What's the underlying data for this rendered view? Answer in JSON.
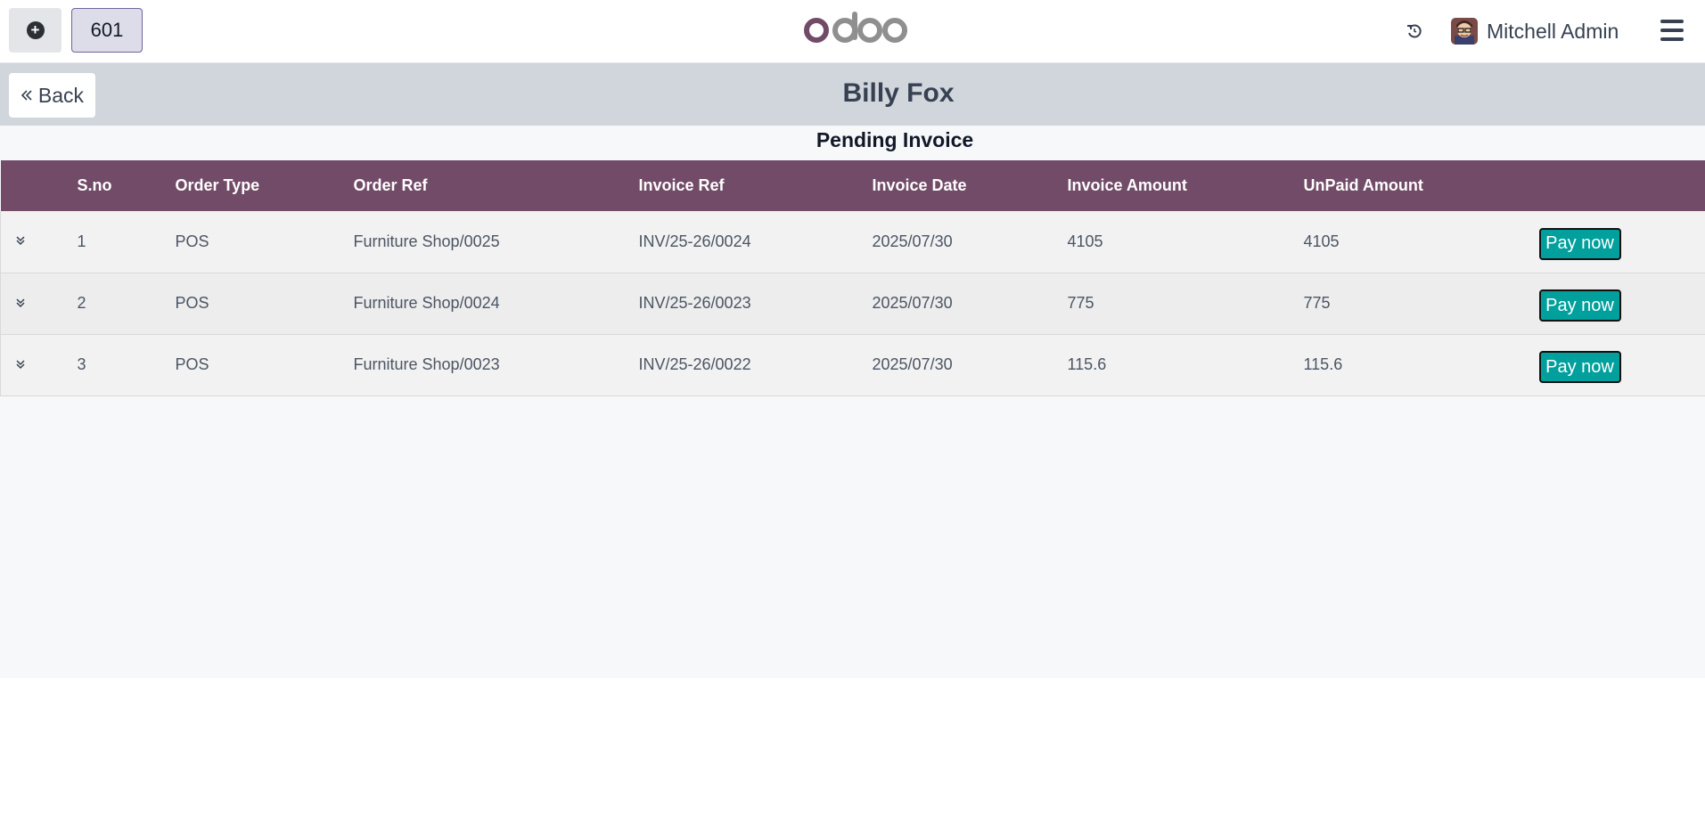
{
  "navbar": {
    "table_number": "601",
    "brand": "odoo",
    "user_name": "Mitchell Admin",
    "icons": [
      "plus-circle-icon",
      "sync-icon",
      "hamburger-menu-icon"
    ]
  },
  "header": {
    "back_label": "Back",
    "title": "Billy Fox"
  },
  "main": {
    "section_title": "Pending Invoice",
    "columns": [
      "S.no",
      "Order Type",
      "Order Ref",
      "Invoice Ref",
      "Invoice Date",
      "Invoice Amount",
      "UnPaid Amount"
    ],
    "rows": [
      {
        "sno": "1",
        "order_type": "POS",
        "order_ref": "Furniture Shop/0025",
        "invoice_ref": "INV/25-26/0024",
        "invoice_date": "2025/07/30",
        "invoice_amount": "4105",
        "unpaid_amount": "4105",
        "action": "Pay now"
      },
      {
        "sno": "2",
        "order_type": "POS",
        "order_ref": "Furniture Shop/0024",
        "invoice_ref": "INV/25-26/0023",
        "invoice_date": "2025/07/30",
        "invoice_amount": "775",
        "unpaid_amount": "775",
        "action": "Pay now"
      },
      {
        "sno": "3",
        "order_type": "POS",
        "order_ref": "Furniture Shop/0023",
        "invoice_ref": "INV/25-26/0022",
        "invoice_date": "2025/07/30",
        "invoice_amount": "115.6",
        "unpaid_amount": "115.6",
        "action": "Pay now"
      }
    ]
  },
  "colors": {
    "brand_purple": "#714b67",
    "header_gray": "#d1d5dc",
    "pay_button": "#01a09d"
  }
}
